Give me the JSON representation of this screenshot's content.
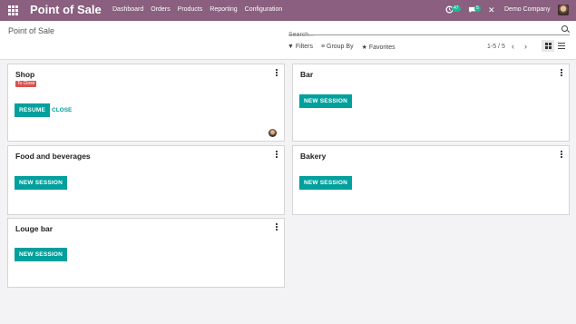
{
  "navbar": {
    "app_title": "Point of Sale",
    "menu": [
      "Dashboard",
      "Orders",
      "Products",
      "Reporting",
      "Configuration"
    ],
    "activity_count": "47",
    "messages_count": "5",
    "company": "Demo Company"
  },
  "control": {
    "breadcrumb": "Point of Sale",
    "search_placeholder": "Search...",
    "filters_label": "Filters",
    "groupby_label": "Group By",
    "favorites_label": "Favorites",
    "pager": "1-5 / 5"
  },
  "cards": [
    {
      "title": "Shop",
      "status": "To Close",
      "primary": "RESUME",
      "secondary": "CLOSE"
    },
    {
      "title": "Bar",
      "primary": "NEW SESSION"
    },
    {
      "title": "Food and beverages",
      "primary": "NEW SESSION"
    },
    {
      "title": "Bakery",
      "primary": "NEW SESSION"
    },
    {
      "title": "Louge bar",
      "primary": "NEW SESSION"
    }
  ],
  "colors": {
    "navbar": "#8a5f7f",
    "accent": "#00a09d",
    "badge": "#21b799",
    "danger": "#d9534f"
  }
}
